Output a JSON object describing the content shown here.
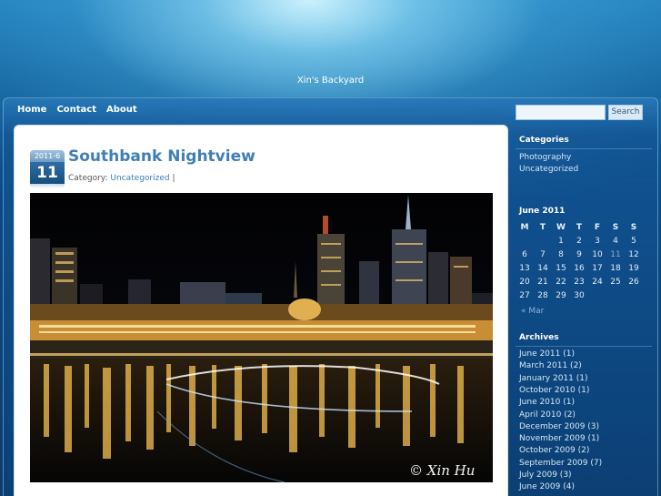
{
  "site": {
    "title": "Xin's Backyard"
  },
  "nav": {
    "items": [
      "Home",
      "Contact",
      "About"
    ]
  },
  "search": {
    "placeholder": "",
    "value": "",
    "button_label": "Search"
  },
  "post": {
    "date_month": "2011-6",
    "date_day": "11",
    "title": "Southbank Nightview",
    "category_label": "Category:",
    "category": "Uncategorized",
    "separator": "|",
    "image_watermark": "© Xin Hu"
  },
  "sidebar": {
    "categories_heading": "Categories",
    "categories": [
      "Photography",
      "Uncategorized"
    ],
    "calendar": {
      "heading": "June 2011",
      "weekdays": [
        "M",
        "T",
        "W",
        "T",
        "F",
        "S",
        "S"
      ],
      "weeks": [
        [
          "",
          "",
          "1",
          "2",
          "3",
          "4",
          "5"
        ],
        [
          "6",
          "7",
          "8",
          "9",
          "10",
          "11",
          "12"
        ],
        [
          "13",
          "14",
          "15",
          "16",
          "17",
          "18",
          "19"
        ],
        [
          "20",
          "21",
          "22",
          "23",
          "24",
          "25",
          "26"
        ],
        [
          "27",
          "28",
          "29",
          "30",
          "",
          "",
          ""
        ]
      ],
      "today": "11",
      "prev_link": "« Mar"
    },
    "archives_heading": "Archives",
    "archives": [
      "June 2011 (1)",
      "March 2011 (2)",
      "January 2011 (1)",
      "October 2010 (1)",
      "June 2010 (1)",
      "April 2010 (2)",
      "December 2009 (3)",
      "November 2009 (1)",
      "October 2009 (2)",
      "September 2009 (7)",
      "July 2009 (3)",
      "June 2009 (4)"
    ]
  }
}
